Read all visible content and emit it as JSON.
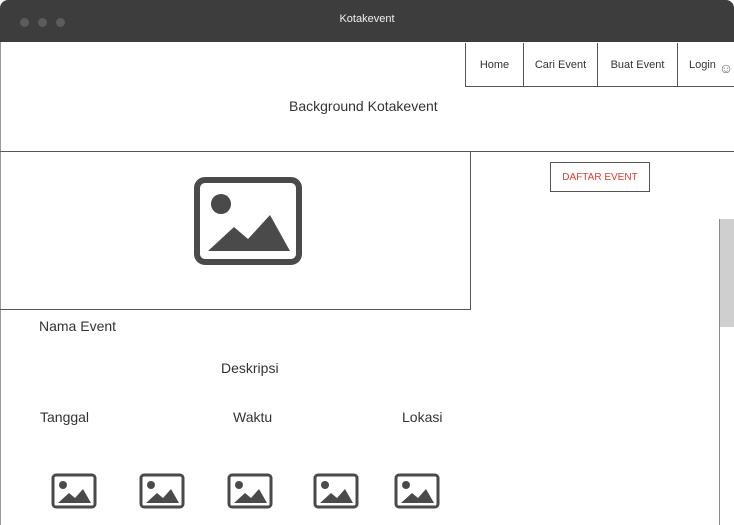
{
  "window": {
    "title": "Kotakevent"
  },
  "nav": {
    "items": [
      {
        "label": "Home"
      },
      {
        "label": "Cari Event"
      },
      {
        "label": "Buat Event"
      },
      {
        "label": "Login"
      }
    ],
    "login_icon": "user-icon"
  },
  "header": {
    "background_label": "Background Kotakevent"
  },
  "hero": {
    "image_icon": "image-placeholder-icon"
  },
  "sidebar": {
    "daftar_label": "DAFTAR EVENT",
    "daftar_color": "#e03a2f"
  },
  "event": {
    "name_label": "Nama Event",
    "description_label": "Deskripsi",
    "date_label": "Tanggal",
    "time_label": "Waktu",
    "location_label": "Lokasi"
  },
  "gallery": {
    "thumbnail_count": 5,
    "thumbnail_icon": "image-placeholder-icon"
  }
}
